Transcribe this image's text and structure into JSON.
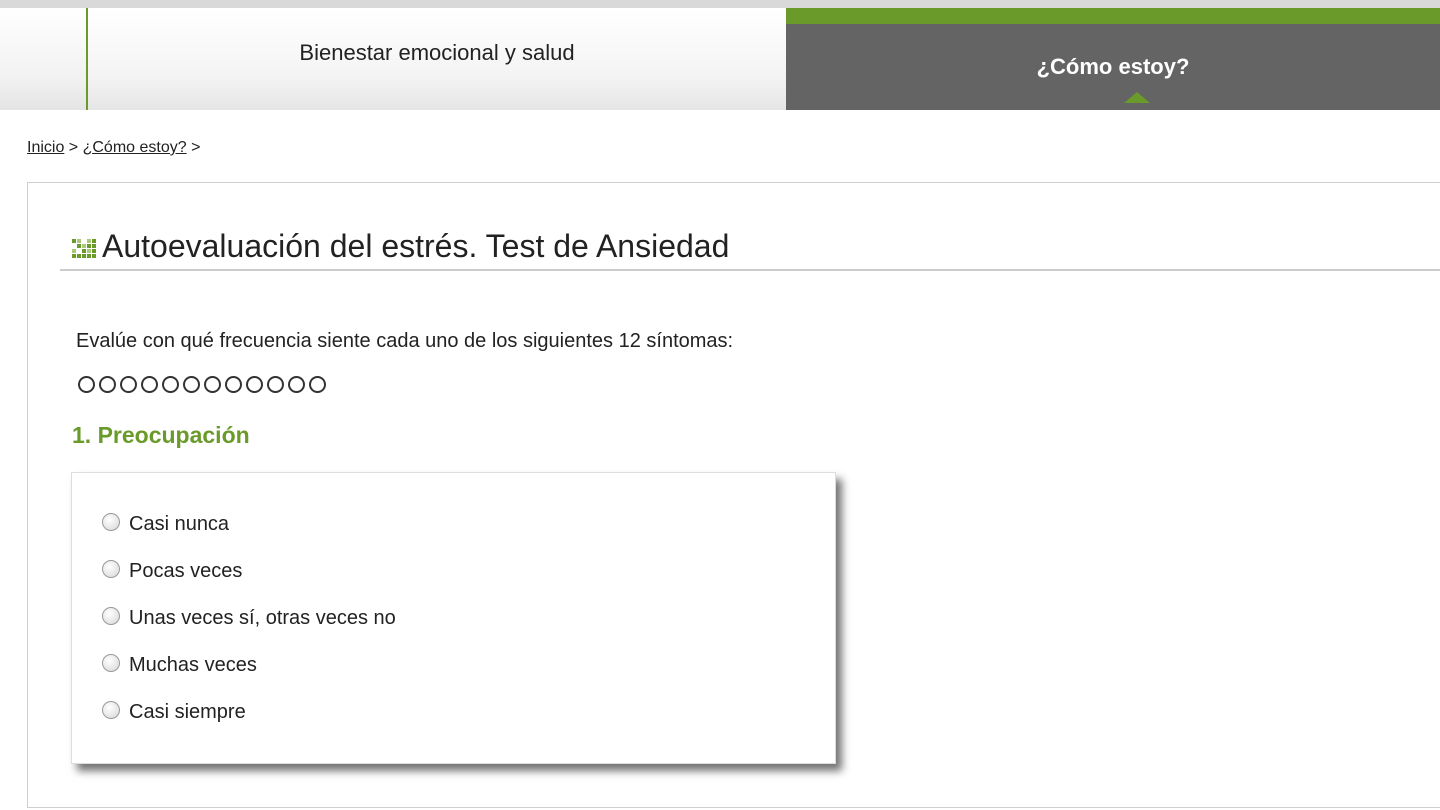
{
  "nav": {
    "tab_label": "Bienestar emocional y salud",
    "active_tab_label": "¿Cómo estoy?"
  },
  "breadcrumb": {
    "home": "Inicio",
    "sep1": " > ",
    "current": "¿Cómo estoy?",
    "sep2": " >"
  },
  "page": {
    "title": "Autoevaluación del estrés. Test de Ansiedad",
    "intro": "Evalúe con qué frecuencia siente cada uno de los siguientes 12 síntomas:"
  },
  "progress": {
    "total_steps": 12,
    "completed_steps": 0
  },
  "question": {
    "title": "1. Preocupación",
    "options": [
      {
        "label": "Casi nunca",
        "selected": false
      },
      {
        "label": "Pocas veces",
        "selected": false
      },
      {
        "label": "Unas veces sí, otras veces no",
        "selected": false
      },
      {
        "label": "Muchas veces",
        "selected": false
      },
      {
        "label": "Casi siempre",
        "selected": false
      }
    ]
  },
  "colors": {
    "accent_green": "#6a9a2a",
    "active_tab_gray": "#646464"
  },
  "icons": {
    "title_icon": "pixel-stairs-icon"
  }
}
